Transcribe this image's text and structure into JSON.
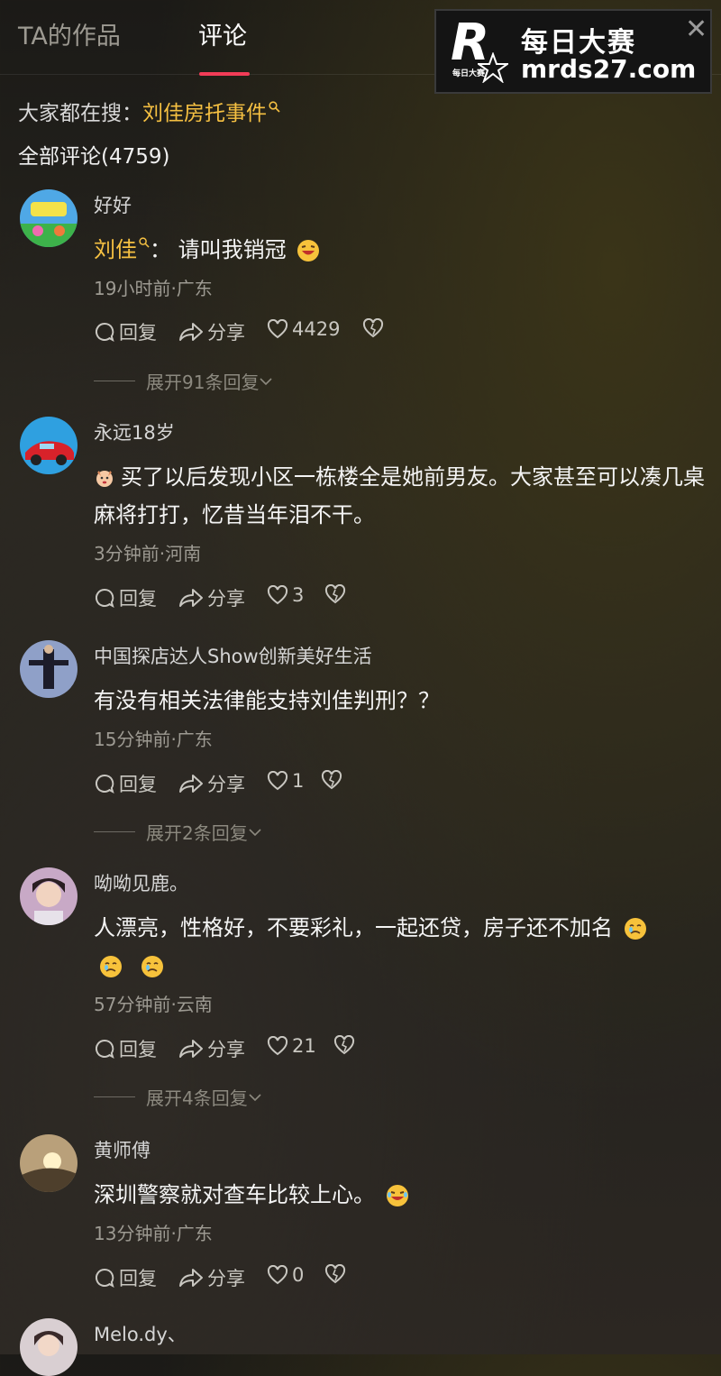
{
  "tabs": {
    "works": "TA的作品",
    "comments": "评论"
  },
  "watermark": {
    "title": "每日大赛",
    "url": "mrds27.com",
    "small": "每日大赛",
    "letter": "R",
    "close": "✕"
  },
  "search": {
    "prefix": "大家都在搜：",
    "term": "刘佳房托事件"
  },
  "comments_total": "全部评论(4759)",
  "labels": {
    "reply": "回复",
    "share": "分享"
  },
  "comments": [
    {
      "user": "好好",
      "mention": "刘佳",
      "text": "：  请叫我销冠",
      "meta": "19小时前·广东",
      "likes": "4429",
      "expand": "展开91条回复"
    },
    {
      "user": "永远18岁",
      "text": "买了以后发现小区一栋楼全是她前男友。大家甚至可以凑几桌麻将打打，忆昔当年泪不干。",
      "meta": "3分钟前·河南",
      "likes": "3"
    },
    {
      "user": "中国探店达人Show创新美好生活",
      "text": "有没有相关法律能支持刘佳判刑？？",
      "meta": "15分钟前·广东",
      "likes": "1",
      "expand": "展开2条回复"
    },
    {
      "user": "呦呦见鹿。",
      "text": "人漂亮，性格好，不要彩礼，一起还贷，房子还不加名",
      "meta": "57分钟前·云南",
      "likes": "21",
      "expand": "展开4条回复"
    },
    {
      "user": "黄师傅",
      "text": "深圳警察就对查车比较上心。",
      "meta": "13分钟前·广东",
      "likes": "0"
    },
    {
      "user": "Melo.dy、"
    }
  ],
  "colors": {
    "accent": "#f23c57",
    "link": "#f5c042"
  },
  "icons": [
    "search-icon",
    "reply-icon",
    "share-icon",
    "like-icon",
    "dislike-icon",
    "chevron-down-icon",
    "close-icon",
    "star-icon"
  ]
}
